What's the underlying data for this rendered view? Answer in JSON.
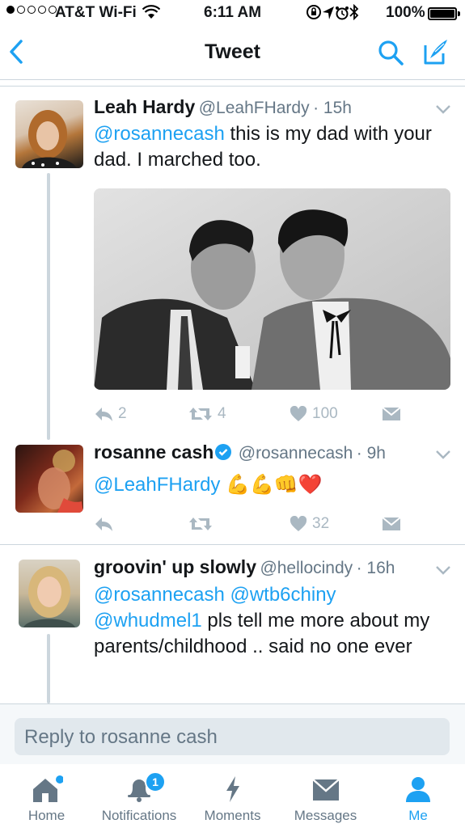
{
  "status_bar": {
    "carrier": "AT&T Wi-Fi",
    "time": "6:11 AM",
    "battery": "100%"
  },
  "nav": {
    "title": "Tweet"
  },
  "tweets": [
    {
      "name": "Leah Hardy",
      "handle": "@LeahFHardy",
      "time": "· 15h",
      "mention": "@rosannecash",
      "text": " this is my dad with your dad. I marched too.",
      "replies": "2",
      "retweets": "4",
      "likes": "100"
    },
    {
      "name": "rosanne cash",
      "handle": "@rosannecash",
      "time": "· 9h",
      "mention": "@LeahFHardy",
      "text": " 💪💪👊❤️",
      "likes": "32"
    },
    {
      "name": "groovin' up slowly",
      "handle": "@hellocindy",
      "time": "· 16h",
      "mentions": "@rosannecash @wtb6chiny",
      "mention2": "@whudmel1",
      "text": " pls tell me more about my parents/childhood .. said no one ever"
    }
  ],
  "reply": {
    "placeholder": "Reply to rosanne cash"
  },
  "tabs": [
    {
      "label": "Home",
      "icon": "home-icon"
    },
    {
      "label": "Notifications",
      "icon": "bell-icon",
      "badge": "1"
    },
    {
      "label": "Moments",
      "icon": "lightning-icon"
    },
    {
      "label": "Messages",
      "icon": "envelope-icon"
    },
    {
      "label": "Me",
      "icon": "person-icon",
      "active": true
    }
  ],
  "colors": {
    "accent": "#1da1f2",
    "muted": "#657786",
    "action": "#aab8c2",
    "divider": "#ccd6dd"
  }
}
